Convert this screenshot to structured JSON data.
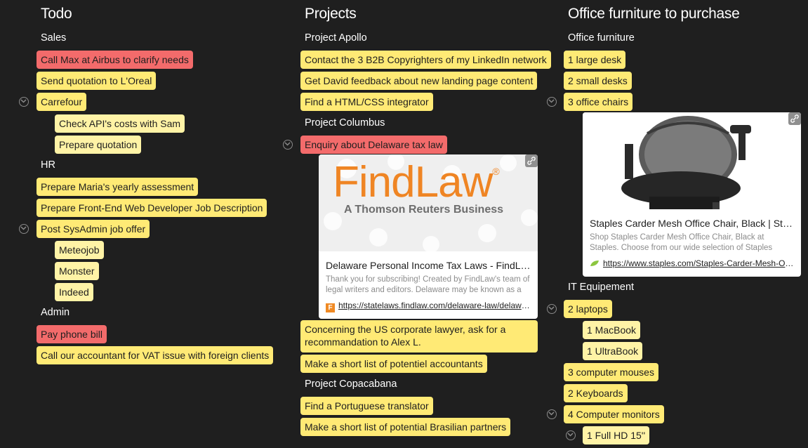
{
  "columns": {
    "todo": {
      "title": "Todo",
      "sections": {
        "sales": {
          "label": "Sales",
          "items": [
            "Call Max at Airbus to clarify needs",
            "Send quotation to L'Oreal",
            "Carrefour"
          ],
          "sub": [
            "Check API's costs with Sam",
            "Prepare quotation"
          ]
        },
        "hr": {
          "label": "HR",
          "items": [
            "Prepare Maria's yearly assessment",
            "Prepare Front-End Web Developer Job Description",
            "Post SysAdmin job offer"
          ],
          "sub": [
            "Meteojob",
            "Monster",
            "Indeed"
          ]
        },
        "admin": {
          "label": "Admin",
          "items": [
            "Pay phone bill",
            "Call our accountant for VAT issue with foreign clients"
          ]
        }
      }
    },
    "projects": {
      "title": "Projects",
      "sections": {
        "apollo": {
          "label": "Project Apollo",
          "items": [
            "Contact the 3 B2B Copyrighters of my LinkedIn network",
            "Get David feedback about new landing page content",
            "Find a HTML/CSS integrator"
          ]
        },
        "columbus": {
          "label": "Project Columbus",
          "items": [
            "Enquiry about Delaware tax law",
            "Concerning the US corporate lawyer, ask for a recommandation to Alex L.",
            "Make a short list of potentiel accountants"
          ]
        },
        "copacabana": {
          "label": "Project Copacabana",
          "items": [
            "Find a Portuguese translator",
            "Make a short list of potential Brasilian partners"
          ]
        }
      },
      "findlaw_preview": {
        "logo_text": "FindLaw",
        "logo_reg": "®",
        "logo_sub": "A Thomson Reuters Business",
        "title": "Delaware Personal Income Tax Laws - FindLaw",
        "desc": "Thank you for subscribing! Created by FindLaw's team of legal writers and editors. Delaware may be known as a",
        "favicon": "F",
        "url": "https://statelaws.findlaw.com/delaware-law/delaware-personal-income-tax-laws.html"
      }
    },
    "furniture": {
      "title": "Office furniture to purchase",
      "sections": {
        "office": {
          "label": "Office furniture",
          "items": [
            "1 large desk",
            "2 small desks",
            "3 office chairs"
          ]
        },
        "it": {
          "label": "IT Equipement",
          "items": [
            "2 laptops",
            "3 computer mouses",
            "2 Keyboards",
            "4 Computer monitors"
          ],
          "sub": [
            "1 MacBook",
            "1 UltraBook",
            "1 Full HD 15''"
          ]
        }
      },
      "staples_preview": {
        "title": "Staples Carder Mesh Office Chair, Black | Staples",
        "desc": "Shop Staples Carder Mesh Office Chair, Black at Staples. Choose from our wide selection of Staples",
        "url": "https://www.staples.com/Staples-Carder-Mesh-Office-Chair-Black/product"
      }
    }
  },
  "colors": {
    "background": "#1f1f1f",
    "card_yellow": "#ffea75",
    "card_red": "#f36b6b",
    "card_sub": "#fff3a6",
    "findlaw_orange": "#f08a24"
  }
}
